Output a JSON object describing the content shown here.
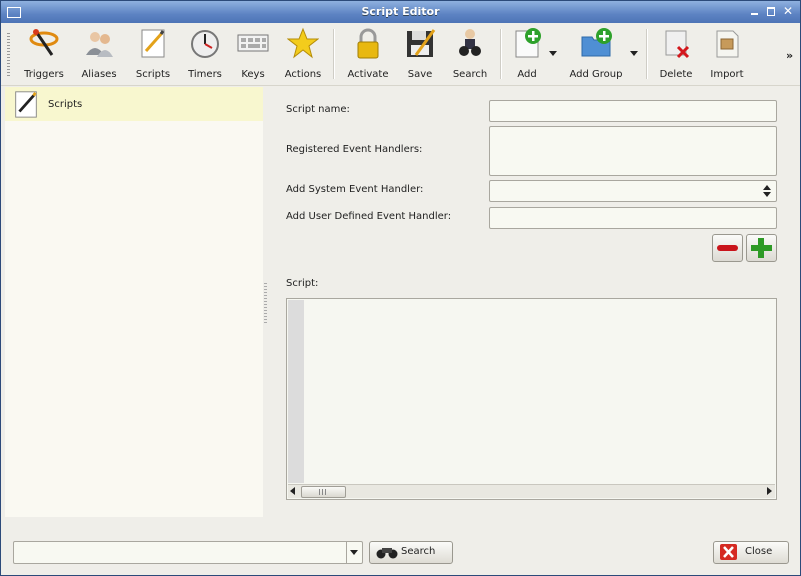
{
  "window": {
    "title": "Script Editor"
  },
  "toolbar": {
    "items": [
      {
        "label": "Triggers",
        "icon": "triggers-icon"
      },
      {
        "label": "Aliases",
        "icon": "aliases-icon"
      },
      {
        "label": "Scripts",
        "icon": "scripts-icon"
      },
      {
        "label": "Timers",
        "icon": "timers-icon"
      },
      {
        "label": "Keys",
        "icon": "keys-icon"
      },
      {
        "label": "Actions",
        "icon": "actions-icon"
      },
      {
        "label": "Activate",
        "icon": "lock-icon"
      },
      {
        "label": "Save",
        "icon": "save-icon"
      },
      {
        "label": "Search",
        "icon": "search-binoculars-icon"
      },
      {
        "label": "Add",
        "icon": "add-item-icon"
      },
      {
        "label": "Add Group",
        "icon": "add-group-icon"
      },
      {
        "label": "Delete",
        "icon": "delete-icon"
      },
      {
        "label": "Import",
        "icon": "import-icon"
      }
    ],
    "overflow": "»"
  },
  "tree": {
    "items": [
      {
        "label": "Scripts"
      }
    ]
  },
  "form": {
    "script_name_label": "Script name:",
    "script_name_value": "",
    "registered_handlers_label": "Registered Event Handlers:",
    "system_handler_label": "Add System Event Handler:",
    "system_handler_value": "",
    "user_handler_label": "Add User Defined Event Handler:",
    "user_handler_value": "",
    "script_label": "Script:",
    "script_value": ""
  },
  "bottom": {
    "search_value": "",
    "search_button": "Search",
    "close_button": "Close"
  },
  "colors": {
    "titlebar": "#5d83c3",
    "selection": "#f8f7cf",
    "minus": "#c9141b",
    "plus": "#2e9a26"
  }
}
